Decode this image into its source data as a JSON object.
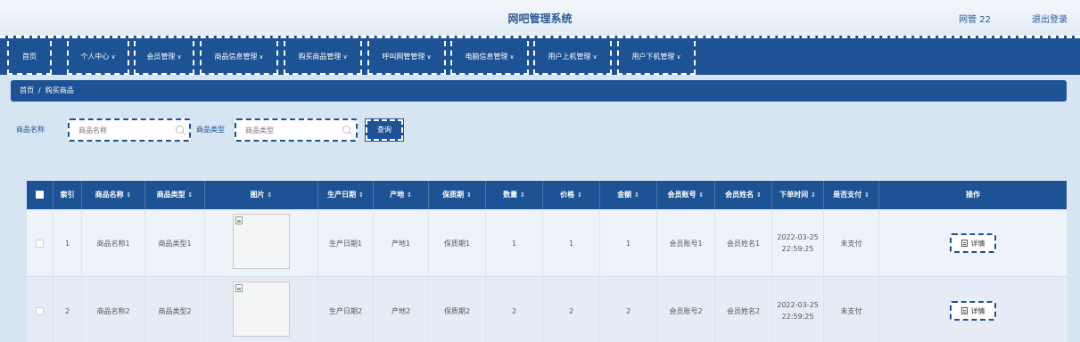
{
  "header": {
    "title": "网吧管理系统",
    "user": "网管 22",
    "logout": "退出登录"
  },
  "nav": {
    "items": [
      {
        "label": "首页",
        "has_menu": false
      },
      {
        "label": "个人中心",
        "has_menu": true
      },
      {
        "label": "会员管理",
        "has_menu": true
      },
      {
        "label": "商品信息管理",
        "has_menu": true
      },
      {
        "label": "购买商品管理",
        "has_menu": true
      },
      {
        "label": "呼叫网管管理",
        "has_menu": true
      },
      {
        "label": "电脑信息管理",
        "has_menu": true
      },
      {
        "label": "用户上机管理",
        "has_menu": true
      },
      {
        "label": "用户下机管理",
        "has_menu": true
      }
    ],
    "chevron": "∨"
  },
  "breadcrumb": {
    "home": "首页",
    "separator": "/",
    "current": "购买商品"
  },
  "search": {
    "name_label": "商品名称",
    "name_placeholder": "商品名称",
    "type_label": "商品类型",
    "type_placeholder": "商品类型",
    "button": "查询"
  },
  "table": {
    "sort_glyph": "⇕",
    "columns": [
      "索引",
      "商品名称",
      "商品类型",
      "图片",
      "生产日期",
      "产地",
      "保质期",
      "数量",
      "价格",
      "金额",
      "会员账号",
      "会员姓名",
      "下单时间",
      "是否支付",
      "操作"
    ],
    "rows": [
      {
        "index": "1",
        "name": "商品名称1",
        "type": "商品类型1",
        "date": "生产日期1",
        "origin": "产地1",
        "shelf": "保质期1",
        "qty": "1",
        "price": "1",
        "amount": "1",
        "account": "会员账号1",
        "member": "会员姓名1",
        "time_date": "2022-03-25",
        "time_clock": "22:59:25",
        "paid": "未支付",
        "action": "详情"
      },
      {
        "index": "2",
        "name": "商品名称2",
        "type": "商品类型2",
        "date": "生产日期2",
        "origin": "产地2",
        "shelf": "保质期2",
        "qty": "2",
        "price": "2",
        "amount": "2",
        "account": "会员账号2",
        "member": "会员姓名2",
        "time_date": "2022-03-25",
        "time_clock": "22:59:25",
        "paid": "未支付",
        "action": "详情"
      }
    ]
  },
  "colors": {
    "primary": "#1d5294",
    "background": "#d7e4f2"
  }
}
